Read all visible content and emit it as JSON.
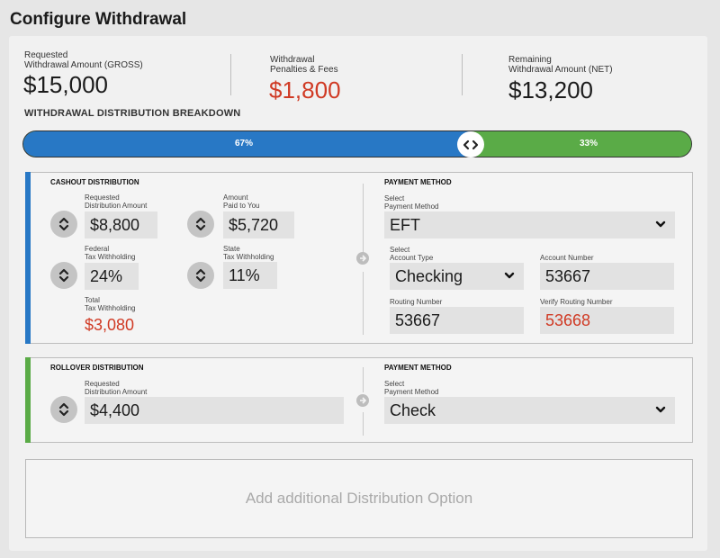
{
  "page": {
    "title": "Configure Withdrawal"
  },
  "summary": {
    "gross": {
      "label_line1": "Requested",
      "label_line2": "Withdrawal  Amount (GROSS)",
      "value": "$15,000"
    },
    "fees": {
      "label_line1": "Withdrawal",
      "label_line2": "Penalties & Fees",
      "value": "$1,800"
    },
    "net": {
      "label_line1": "Remaining",
      "label_line2": "Withdrawal Amount (NET)",
      "value": "$13,200"
    }
  },
  "breakdown": {
    "heading": "WITHDRAWAL DISTRIBUTION BREAKDOWN",
    "cashout_share": 0.67,
    "cashout_percent": "67%",
    "rollover_percent": "33%",
    "handle_glyph": "‹›",
    "colors": {
      "cashout": "#2878c5",
      "rollover": "#5aab47"
    }
  },
  "cashout": {
    "title": "CASHOUT DISTRIBUTION",
    "requested": {
      "label_line1": "Requested",
      "label_line2": "Distribution Amount",
      "value": "$8,800"
    },
    "paid": {
      "label_line1": "Amount",
      "label_line2": "Paid to You",
      "value": "$5,720"
    },
    "federal": {
      "label_line1": "Federal",
      "label_line2": "Tax Withholding",
      "value": "24%"
    },
    "state": {
      "label_line1": "State",
      "label_line2": "Tax Withholding",
      "value": "11%"
    },
    "total": {
      "label_line1": "Total",
      "label_line2": "Tax Withholding",
      "value": "$3,080"
    },
    "payment": {
      "title": "PAYMENT METHOD",
      "method": {
        "label_line1": "Select",
        "label_line2": "Payment Method",
        "value": "EFT"
      },
      "account_type": {
        "label_line1": "Select",
        "label_line2": "Account Type",
        "value": "Checking"
      },
      "account_number": {
        "label": "Account Number",
        "value": "53667"
      },
      "routing_number": {
        "label": "Routing Number",
        "value": "53667"
      },
      "verify_routing": {
        "label": "Verify Routing Number",
        "value": "53668"
      }
    }
  },
  "rollover": {
    "title": "ROLLOVER DISTRIBUTION",
    "requested": {
      "label_line1": "Requested",
      "label_line2": "Distribution Amount",
      "value": "$4,400"
    },
    "payment": {
      "title": "PAYMENT METHOD",
      "method": {
        "label_line1": "Select",
        "label_line2": "Payment Method",
        "value": "Check"
      }
    }
  },
  "add_option": {
    "label": "Add additional Distribution Option"
  },
  "icons": {
    "stepper": "up-down-chevron-icon",
    "select": "chevron-down-icon",
    "flow": "arrow-right-circle-icon",
    "handle": "left-right-drag-icon"
  }
}
